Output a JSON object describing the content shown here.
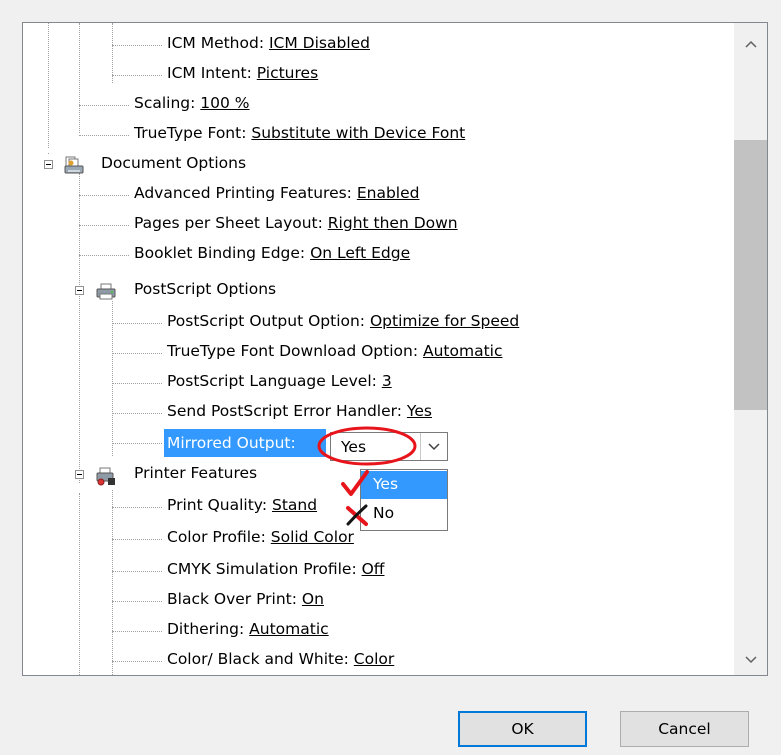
{
  "tree": {
    "items": [
      {
        "label": "ICM Method: ",
        "value": "ICM Disabled"
      },
      {
        "label": "ICM Intent: ",
        "value": "Pictures"
      },
      {
        "label": "Scaling: ",
        "value": "100 %"
      },
      {
        "label": "TrueType Font: ",
        "value": "Substitute with Device Font"
      },
      {
        "label": "Document Options",
        "value": ""
      },
      {
        "label": "Advanced Printing Features: ",
        "value": "Enabled"
      },
      {
        "label": "Pages per Sheet Layout: ",
        "value": "Right then Down"
      },
      {
        "label": "Booklet Binding Edge: ",
        "value": "On Left Edge"
      },
      {
        "label": "PostScript Options",
        "value": ""
      },
      {
        "label": "PostScript Output Option: ",
        "value": "Optimize for Speed"
      },
      {
        "label": "TrueType Font Download Option: ",
        "value": "Automatic"
      },
      {
        "label": "PostScript Language Level: ",
        "value": "3"
      },
      {
        "label": "Send PostScript Error Handler: ",
        "value": "Yes"
      },
      {
        "label": "Mirrored Output:",
        "value": ""
      },
      {
        "label": "Printer Features",
        "value": ""
      },
      {
        "label": "Print Quality: ",
        "value": "Stand"
      },
      {
        "label": "Color Profile: ",
        "value": "Solid Color"
      },
      {
        "label": "CMYK Simulation Profile: ",
        "value": "Off"
      },
      {
        "label": "Black Over Print: ",
        "value": "On"
      },
      {
        "label": "Dithering: ",
        "value": "Automatic"
      },
      {
        "label": "Color/ Black and White: ",
        "value": "Color"
      }
    ]
  },
  "combo": {
    "selected": "Yes",
    "options": [
      "Yes",
      "No"
    ]
  },
  "buttons": {
    "ok": "OK",
    "cancel": "Cancel"
  },
  "colors": {
    "selection": "#3399ff",
    "annotation_red": "#e8141b",
    "default_button_border": "#0078d7"
  },
  "icons": {
    "combo_arrow": "chevron-down-icon",
    "scroll_up": "chevron-up-icon",
    "scroll_down": "chevron-down-icon",
    "check": "check-mark-icon",
    "cross": "cross-mark-icon"
  }
}
